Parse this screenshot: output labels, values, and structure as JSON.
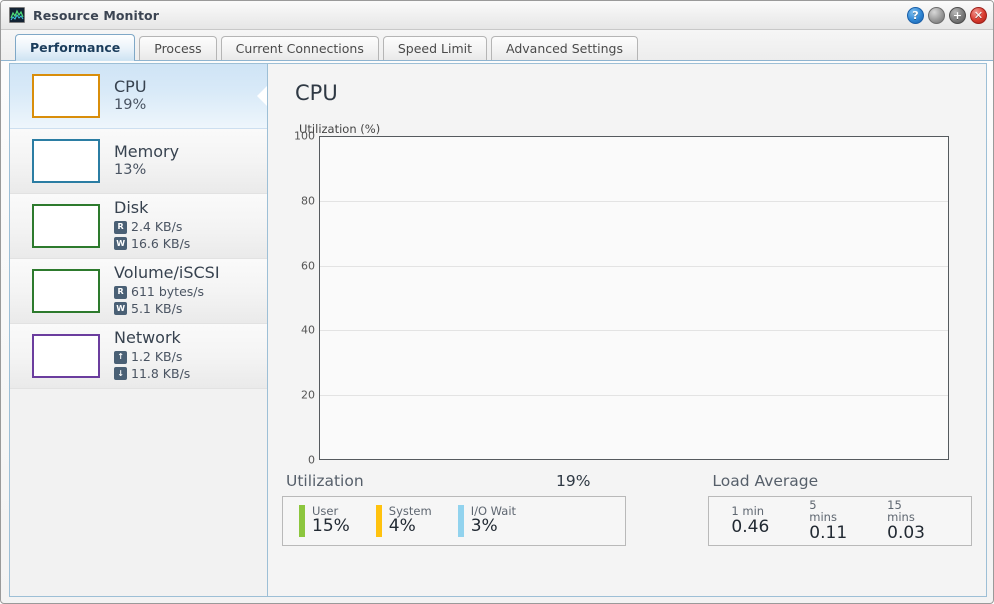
{
  "window": {
    "title": "Resource Monitor",
    "icon": "resource-monitor-icon",
    "buttons": {
      "help": "?",
      "minimize": "",
      "maximize": "+",
      "close": "✕"
    }
  },
  "tabs": [
    {
      "label": "Performance",
      "active": true
    },
    {
      "label": "Process",
      "active": false
    },
    {
      "label": "Current Connections",
      "active": false
    },
    {
      "label": "Speed Limit",
      "active": false
    },
    {
      "label": "Advanced Settings",
      "active": false
    }
  ],
  "sidebar": {
    "items": [
      {
        "name": "cpu",
        "label": "CPU",
        "selected": true,
        "color": "#d98e0b",
        "value": "19%",
        "metrics": []
      },
      {
        "name": "memory",
        "label": "Memory",
        "selected": false,
        "color": "#2b7da3",
        "value": "13%",
        "metrics": []
      },
      {
        "name": "disk",
        "label": "Disk",
        "selected": false,
        "color": "#2d7a2d",
        "value": "",
        "metrics": [
          {
            "badge": "R",
            "icon": "read-badge",
            "text": "2.4 KB/s"
          },
          {
            "badge": "W",
            "icon": "write-badge",
            "text": "16.6 KB/s"
          }
        ]
      },
      {
        "name": "volume-iscsi",
        "label": "Volume/iSCSI",
        "selected": false,
        "color": "#2d7a2d",
        "value": "",
        "metrics": [
          {
            "badge": "R",
            "icon": "read-badge",
            "text": "611 bytes/s"
          },
          {
            "badge": "W",
            "icon": "write-badge",
            "text": "5.1 KB/s"
          }
        ]
      },
      {
        "name": "network",
        "label": "Network",
        "selected": false,
        "color": "#6b3d9e",
        "value": "",
        "metrics": [
          {
            "badge": "↑",
            "icon": "upload-arrow-badge",
            "text": "1.2 KB/s"
          },
          {
            "badge": "↓",
            "icon": "download-arrow-badge",
            "text": "11.8 KB/s"
          }
        ]
      }
    ]
  },
  "main": {
    "title": "CPU",
    "utilization": {
      "header_label": "Utilization",
      "header_value": "19%",
      "items": [
        {
          "label": "User",
          "value": "15%",
          "color": "#8cc63e"
        },
        {
          "label": "System",
          "value": "4%",
          "color": "#ffc20e"
        },
        {
          "label": "I/O Wait",
          "value": "3%",
          "color": "#92d3ee"
        }
      ]
    },
    "load_average": {
      "header_label": "Load Average",
      "items": [
        {
          "label": "1 min",
          "value": "0.46"
        },
        {
          "label": "5 mins",
          "value": "0.11"
        },
        {
          "label": "15 mins",
          "value": "0.03"
        }
      ]
    }
  },
  "chart_data": {
    "type": "line",
    "title": "CPU",
    "ylabel": "Utilization (%)",
    "xlabel": "",
    "ylim": [
      0,
      100
    ],
    "yticks": [
      0,
      20,
      40,
      60,
      80,
      100
    ],
    "grid": true,
    "legend": "none",
    "series": [
      {
        "name": "User",
        "color": "#8cc63e",
        "x": [],
        "values": []
      },
      {
        "name": "System",
        "color": "#ffc20e",
        "x": [],
        "values": []
      },
      {
        "name": "I/O Wait",
        "color": "#92d3ee",
        "x": [],
        "values": []
      }
    ],
    "note": "Plot area is empty — no data points are drawn in the screenshot."
  }
}
